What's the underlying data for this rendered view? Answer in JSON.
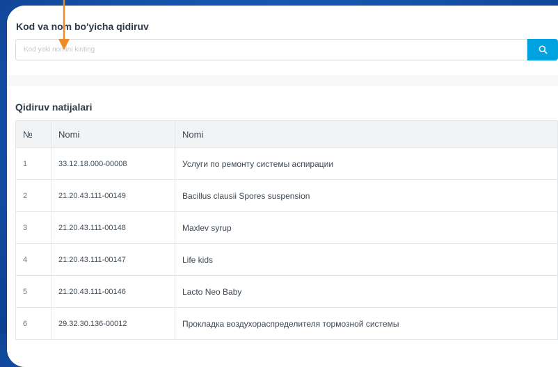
{
  "search": {
    "title": "Kod va nom bo'yicha qidiruv",
    "placeholder": "Kod yoki nomini kiriting",
    "button_icon": "search-icon"
  },
  "results": {
    "title": "Qidiruv natijalari",
    "columns": [
      "№",
      "Nomi",
      "Nomi"
    ],
    "rows": [
      {
        "num": "1",
        "code": "33.12.18.000-00008",
        "name": "Услуги по ремонту системы аспирации"
      },
      {
        "num": "2",
        "code": "21.20.43.111-00149",
        "name": "Bacillus clausii Spores suspension"
      },
      {
        "num": "3",
        "code": "21.20.43.111-00148",
        "name": "Maxlev syrup"
      },
      {
        "num": "4",
        "code": "21.20.43.111-00147",
        "name": "Life kids"
      },
      {
        "num": "5",
        "code": "21.20.43.111-00146",
        "name": "Lacto Neo Baby"
      },
      {
        "num": "6",
        "code": "29.32.30.136-00012",
        "name": "Прокладка воздухораспределителя тормозной системы"
      }
    ]
  },
  "colors": {
    "background": "#1553ab",
    "accent": "#00a3e0",
    "annotation_arrow": "#f08a24"
  }
}
